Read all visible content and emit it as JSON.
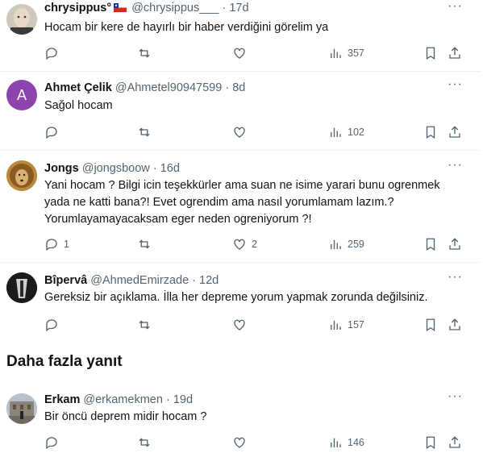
{
  "replies": [
    {
      "name": "chrysippus°",
      "handle": "@chrysippus___",
      "time": "17d",
      "text": "Hocam bir kere de hayırlı bir haber verdiğini görelim ya",
      "replies": "",
      "likes": "",
      "views": "357",
      "has_flag": true,
      "avatar": "bald-man"
    },
    {
      "name": "Ahmet Çelik",
      "handle": "@Ahmetel90947599",
      "time": "8d",
      "text": "Sağol hocam",
      "replies": "",
      "likes": "",
      "views": "102",
      "avatar_letter": "A",
      "avatar_color": "#8e44ad"
    },
    {
      "name": "Jongs",
      "handle": "@jongsboow",
      "time": "16d",
      "text": "Yani hocam ? Bilgi icin teşekkürler ama suan ne isime yarari bunu ogrenmek yada ne katti bana?! Evet ogrendim ama nasıl yorumlamam lazım.? Yorumlayamayacaksam eger neden ogreniyorum ?!",
      "replies": "1",
      "likes": "2",
      "views": "259",
      "avatar": "lion"
    },
    {
      "name": "Bîpervâ",
      "handle": "@AhmedEmirzade",
      "time": "12d",
      "text": "Gereksiz bir açıklama. İlla her depreme yorum yapmak zorunda değilsiniz.",
      "replies": "",
      "likes": "",
      "views": "157",
      "avatar": "dark-figure"
    },
    {
      "name": "Erkam",
      "handle": "@erkamekmen",
      "time": "19d",
      "text": "Bir öncü deprem midir hocam ?",
      "replies": "",
      "likes": "",
      "views": "146",
      "avatar": "building-photo"
    }
  ],
  "section_title": "Daha fazla yanıt",
  "sep": "·",
  "more": "···",
  "colors": {
    "text": "#0f1419",
    "muted": "#536471",
    "border": "#eff3f4"
  }
}
